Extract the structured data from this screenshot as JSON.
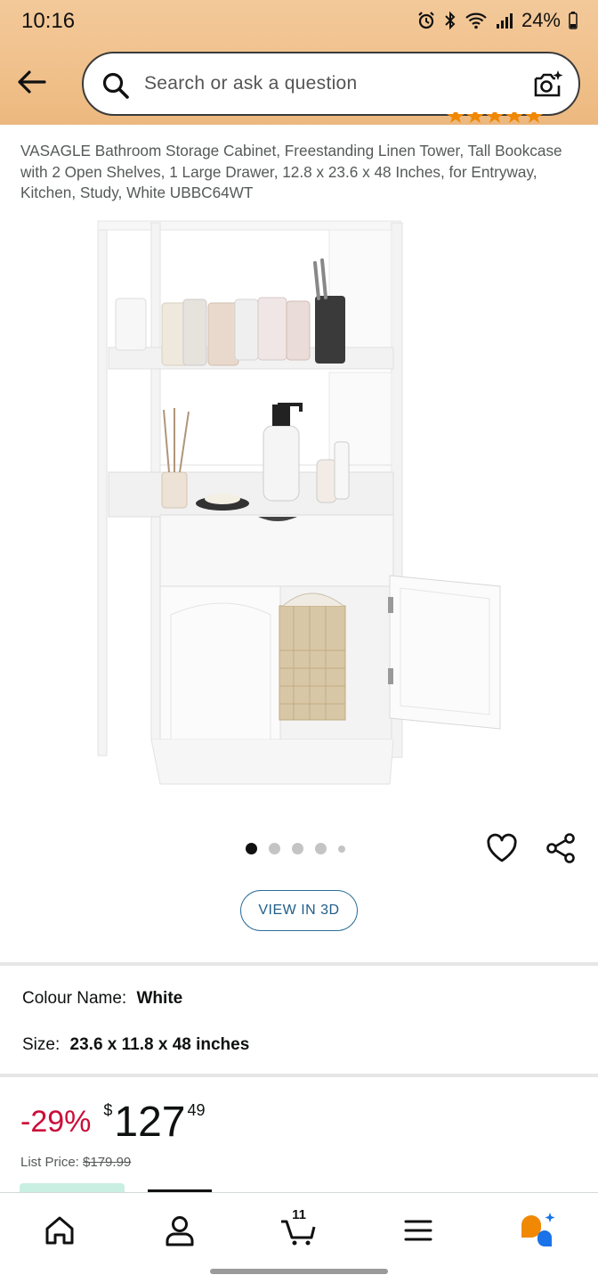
{
  "status_bar": {
    "time": "10:16",
    "battery": "24%"
  },
  "search": {
    "placeholder": "Search or ask a question"
  },
  "product": {
    "title": "VASAGLE Bathroom Storage Cabinet, Freestanding Linen Tower, Tall Bookcase with 2 Open Shelves, 1 Large Drawer, 12.8 x 23.6 x 48 Inches, for Entryway, Kitchen, Study, White UBBC64WT",
    "image_count": 5,
    "active_image": 1,
    "view_3d_label": "VIEW IN 3D"
  },
  "attributes": {
    "colour_label": "Colour Name:",
    "colour_value": "White",
    "size_label": "Size:",
    "size_value": "23.6 x 11.8 x 48 inches"
  },
  "price": {
    "discount": "-29%",
    "currency": "$",
    "whole": "127",
    "fraction": "49",
    "list_label": "List Price:",
    "list_value": "$179.99"
  },
  "bottom_nav": {
    "cart_count": "11",
    "items": [
      "home-icon",
      "account-icon",
      "cart-icon",
      "menu-icon",
      "rufus-icon"
    ]
  },
  "colors": {
    "accent": "#cc0c39",
    "link": "#1f5e8a",
    "header_gradient": "#f0c08a"
  }
}
